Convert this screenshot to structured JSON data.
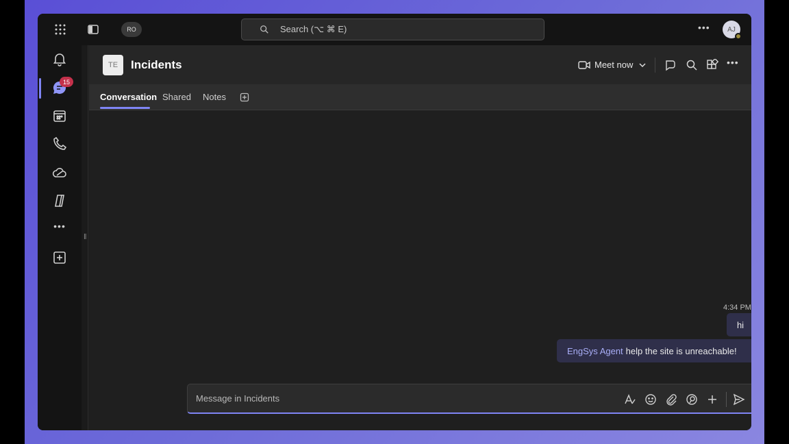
{
  "titlebar": {
    "account_chip": "RO",
    "search_placeholder": "Search (⌥ ⌘ E)",
    "avatar_initials": "AJ"
  },
  "rail": {
    "chat_badge": "15"
  },
  "header": {
    "team_initials": "TE",
    "channel_title": "Incidents",
    "meet_now_label": "Meet now"
  },
  "tabs": [
    {
      "label": "Conversation",
      "active": true
    },
    {
      "label": "Shared",
      "active": false
    },
    {
      "label": "Notes",
      "active": false
    }
  ],
  "messages": {
    "timestamp": "4:34 PM",
    "items": [
      {
        "text": "hi"
      },
      {
        "mention": "EngSys Agent",
        "text": "help the site is unreachable!"
      }
    ]
  },
  "composer": {
    "placeholder": "Message in Incidents"
  },
  "colors": {
    "accent": "#7f85f5",
    "badge": "#c4314b",
    "bubble": "#2f2f4a"
  }
}
